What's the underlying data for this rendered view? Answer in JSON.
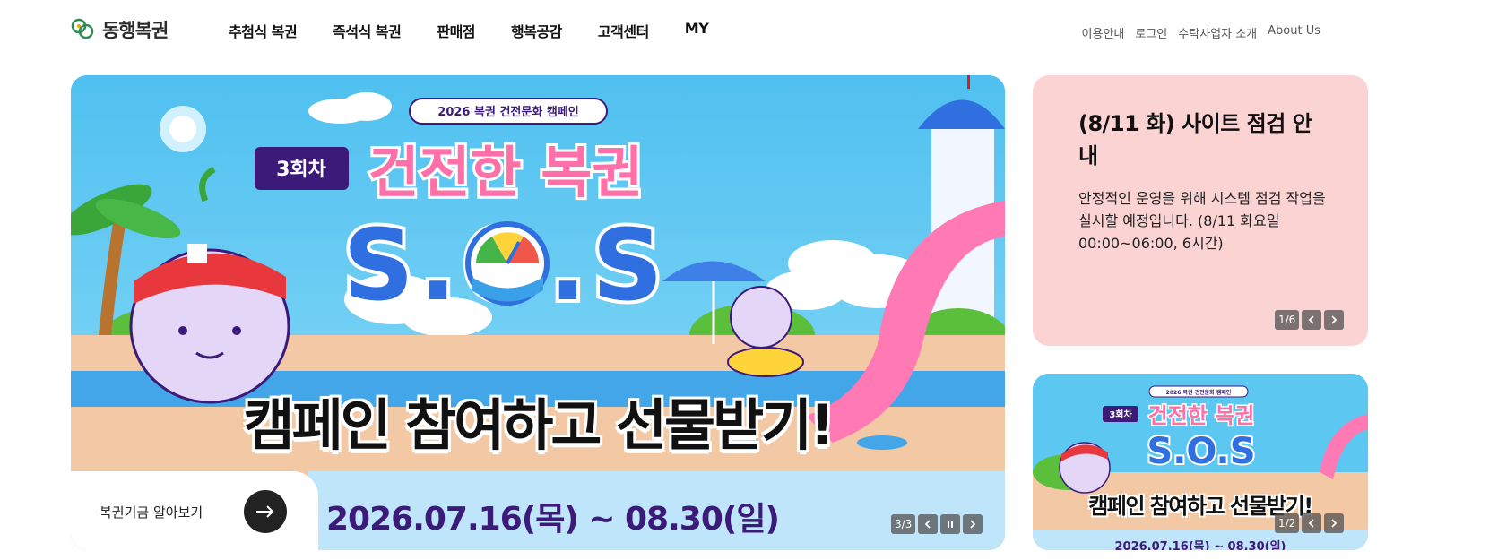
{
  "header": {
    "logo_text": "동행복권",
    "gnb": [
      "추첨식 복권",
      "즉석식 복권",
      "판매점",
      "행복공감",
      "고객센터",
      "MY"
    ],
    "util": [
      "이용안내",
      "로그인",
      "수탁사업자 소개",
      "About Us"
    ]
  },
  "main_banner": {
    "tag": "2026 복권 건전문화 캠페인",
    "round": "3회차",
    "headline": "건전한 복권",
    "sos": "S.O.S",
    "title": "캠페인 참여하고 선물받기!",
    "date": "2026.07.16(목) ~ 08.30(일)",
    "fund_label": "복권기금 알아보기",
    "counter": "3/3"
  },
  "notice": {
    "title": "(8/11 화) 사이트 점검 안내",
    "body": "안정적인 운영을 위해 시스템 점검 작업을 실시할 예정입니다. (8/11 화요일 00:00~06:00, 6시간)",
    "counter": "1/6"
  },
  "sub_banner": {
    "tag": "2026 복권 건전문화 캠페인",
    "round": "3회차",
    "headline": "건전한 복권",
    "sos": "S.O.S",
    "title": "캠페인 참여하고 선물받기!",
    "date": "2026.07.16(목) ~ 08.30(일)",
    "counter": "1/2"
  },
  "colors": {
    "sky": "#57c6f2",
    "notice_bg": "#fbd3d3",
    "brand_purple": "#3c1a7a",
    "pink": "#ff6fa8",
    "blue": "#2f6fe0"
  },
  "icons": {
    "prev": "chevron-left-icon",
    "next": "chevron-right-icon",
    "pause": "pause-icon",
    "arrow": "arrow-right-icon"
  }
}
